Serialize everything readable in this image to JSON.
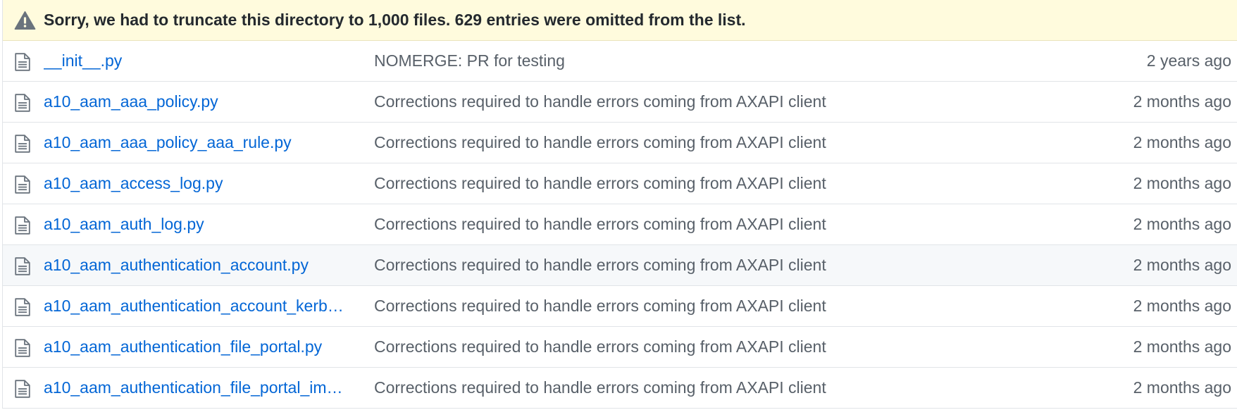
{
  "notice": {
    "icon": "alert-icon",
    "text": "Sorry, we had to truncate this directory to 1,000 files. 629 entries were omitted from the list."
  },
  "files": [
    {
      "icon": "file-icon",
      "name": "__init__.py",
      "message": "NOMERGE: PR for testing",
      "age": "2 years ago"
    },
    {
      "icon": "file-icon",
      "name": "a10_aam_aaa_policy.py",
      "message": "Corrections required to handle errors coming from AXAPI client",
      "age": "2 months ago"
    },
    {
      "icon": "file-icon",
      "name": "a10_aam_aaa_policy_aaa_rule.py",
      "message": "Corrections required to handle errors coming from AXAPI client",
      "age": "2 months ago"
    },
    {
      "icon": "file-icon",
      "name": "a10_aam_access_log.py",
      "message": "Corrections required to handle errors coming from AXAPI client",
      "age": "2 months ago"
    },
    {
      "icon": "file-icon",
      "name": "a10_aam_auth_log.py",
      "message": "Corrections required to handle errors coming from AXAPI client",
      "age": "2 months ago"
    },
    {
      "icon": "file-icon",
      "name": "a10_aam_authentication_account.py",
      "message": "Corrections required to handle errors coming from AXAPI client",
      "age": "2 months ago",
      "hovered": true
    },
    {
      "icon": "file-icon",
      "name": "a10_aam_authentication_account_kerb…",
      "message": "Corrections required to handle errors coming from AXAPI client",
      "age": "2 months ago"
    },
    {
      "icon": "file-icon",
      "name": "a10_aam_authentication_file_portal.py",
      "message": "Corrections required to handle errors coming from AXAPI client",
      "age": "2 months ago"
    },
    {
      "icon": "file-icon",
      "name": "a10_aam_authentication_file_portal_im…",
      "message": "Corrections required to handle errors coming from AXAPI client",
      "age": "2 months ago"
    }
  ],
  "colors": {
    "link": "#0366d6",
    "muted": "#586069",
    "flash_bg": "#fffbdd",
    "border": "#e1e4e8",
    "hover_bg": "#f6f8fa"
  }
}
